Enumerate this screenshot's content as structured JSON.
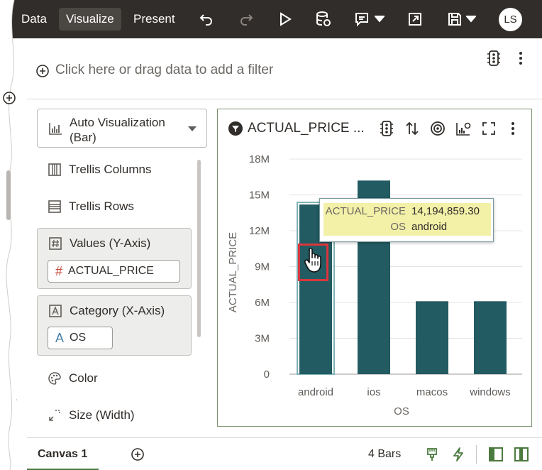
{
  "topbar": {
    "tabs": [
      {
        "label": "Data"
      },
      {
        "label": "Visualize"
      },
      {
        "label": "Present"
      }
    ],
    "icons": [
      "undo-icon",
      "redo-icon",
      "run-icon",
      "database-refresh-icon",
      "comment-icon",
      "export-icon",
      "save-icon"
    ],
    "avatar_initials": "LS"
  },
  "filterbar": {
    "placeholder": "Click here or drag data to add a filter"
  },
  "grammar": {
    "viz_type_label": "Auto Visualization\n(Bar)",
    "trellis_columns": "Trellis Columns",
    "trellis_rows": "Trellis Rows",
    "values_label": "Values (Y-Axis)",
    "values_pill": "ACTUAL_PRICE",
    "category_label": "Category (X-Axis)",
    "category_pill": "OS",
    "color": "Color",
    "size": "Size (Width)"
  },
  "card": {
    "title": "ACTUAL_PRICE ..."
  },
  "tooltip": {
    "key1": "ACTUAL_PRICE",
    "val1": "14,194,859.30",
    "key2": "OS",
    "val2": "android"
  },
  "bottombar": {
    "canvas_tab": "Canvas 1",
    "bars_count": "4 Bars"
  },
  "colors": {
    "bar": "#225b61",
    "topbar": "#312d2a",
    "accent_green": "#4b7a3e"
  },
  "chart_data": {
    "type": "bar",
    "categories": [
      "android",
      "ios",
      "macos",
      "windows"
    ],
    "values": [
      14194859.3,
      16200000,
      6100000,
      6100000
    ],
    "xlabel": "OS",
    "ylabel": "ACTUAL_PRICE",
    "ylim": [
      0,
      18000000
    ],
    "yticks": [
      0,
      3000000,
      6000000,
      9000000,
      12000000,
      15000000,
      18000000
    ],
    "ytick_labels": [
      "0",
      "3M",
      "6M",
      "9M",
      "12M",
      "15M",
      "18M"
    ],
    "grid": true,
    "selected": "android"
  }
}
